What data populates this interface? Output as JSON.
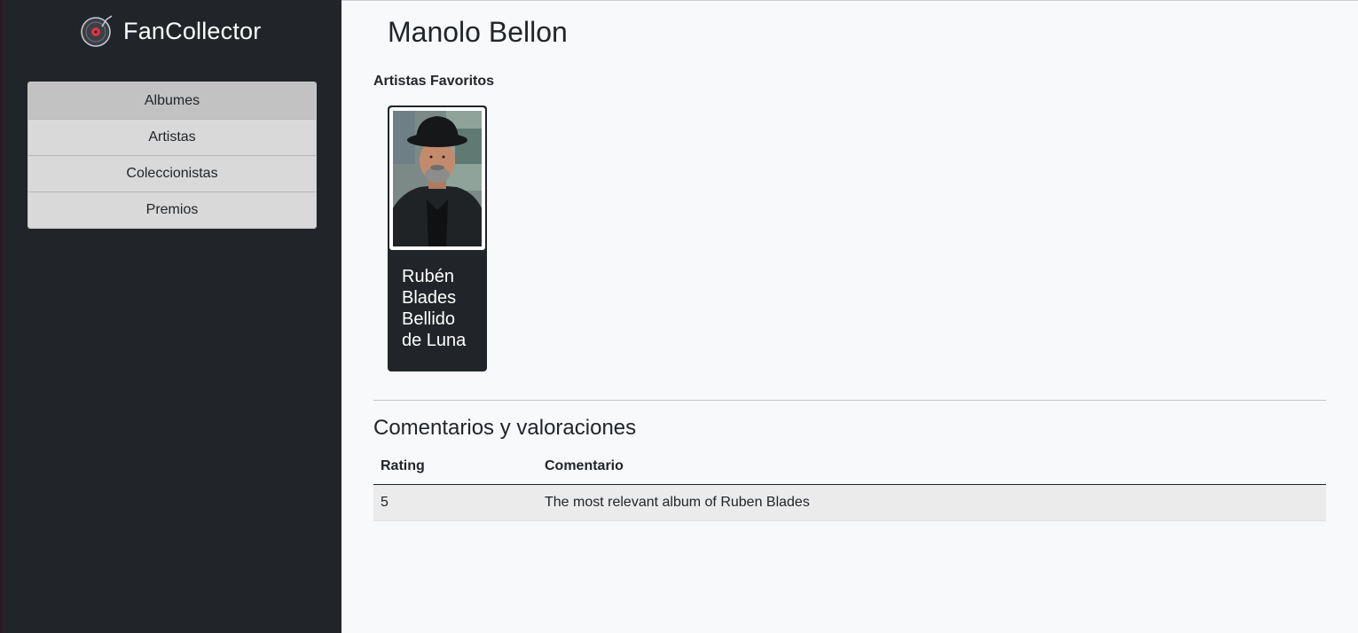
{
  "app": {
    "brand": "FanCollector",
    "brand_icon": "vinyl-record-icon",
    "accent_color": "#dc3545"
  },
  "sidebar": {
    "items": [
      {
        "label": "Albumes"
      },
      {
        "label": "Artistas"
      },
      {
        "label": "Coleccionistas"
      },
      {
        "label": "Premios"
      }
    ]
  },
  "profile": {
    "name": "Manolo Bellon",
    "favorites_label": "Artistas Favoritos",
    "favorites": [
      {
        "name": "Rubén Blades Bellido de Luna"
      }
    ]
  },
  "comments": {
    "title": "Comentarios y valoraciones",
    "headers": [
      "Rating",
      "Comentario"
    ],
    "rows": [
      {
        "rating": "5",
        "comment": "The most relevant album of Ruben Blades"
      }
    ]
  }
}
